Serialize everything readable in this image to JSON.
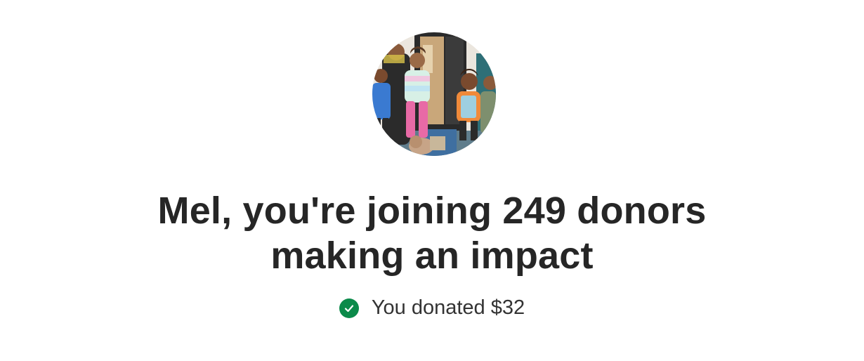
{
  "header": {
    "line1": "Mel, you're joining 249 donors",
    "line2": "making an impact"
  },
  "status": {
    "icon": "check-circle-icon",
    "icon_color": "#0b8a4a",
    "text": "You donated $32"
  },
  "avatar": {
    "alt": "fundraiser photo"
  }
}
